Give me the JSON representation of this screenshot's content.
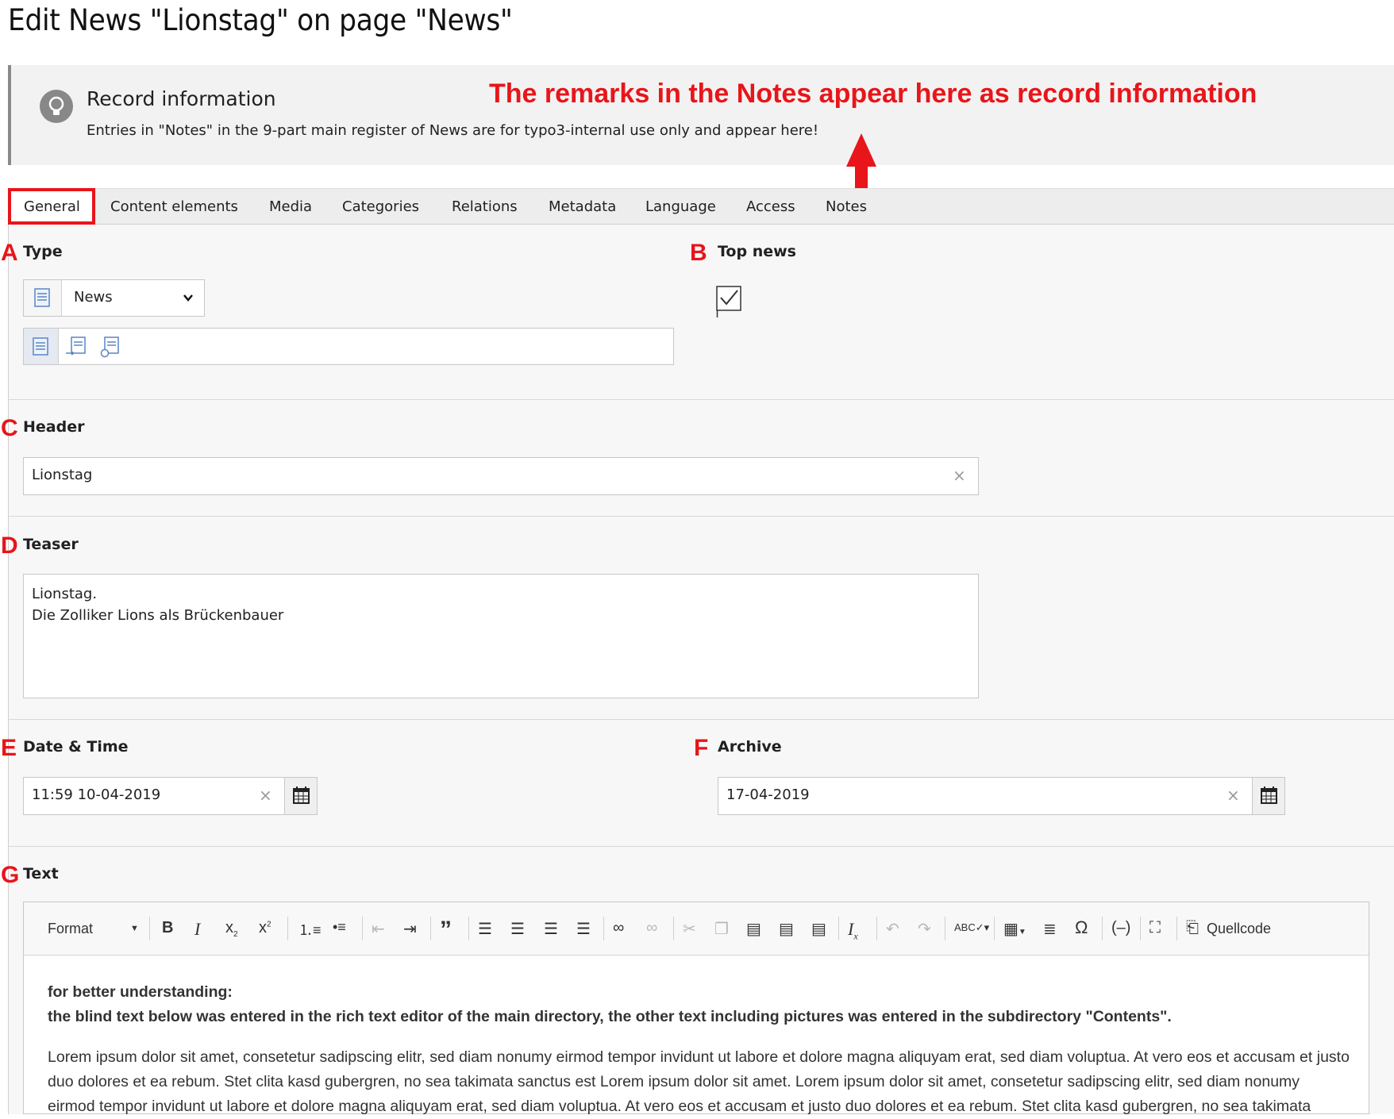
{
  "page": {
    "title": "Edit News \"Lionstag\" on page \"News\""
  },
  "record_info": {
    "title": "Record information",
    "text": "Entries in \"Notes\" in the 9-part main register of News are for typo3-internal use only and appear here!"
  },
  "annotation": {
    "main": "The remarks in the Notes appear here as record information"
  },
  "tabs": [
    "General",
    "Content elements",
    "Media",
    "Categories",
    "Relations",
    "Metadata",
    "Language",
    "Access",
    "Notes"
  ],
  "fields": {
    "type": {
      "marker": "A",
      "label": "Type",
      "value": "News"
    },
    "top_news": {
      "marker": "B",
      "label": "Top news",
      "checked": true
    },
    "header": {
      "marker": "C",
      "label": "Header",
      "value": "Lionstag"
    },
    "teaser": {
      "marker": "D",
      "label": "Teaser",
      "line1": "Lionstag.",
      "line2": "Die Zolliker Lions als Brückenbauer"
    },
    "datetime": {
      "marker": "E",
      "label": "Date & Time",
      "value": "11:59 10-04-2019"
    },
    "archive": {
      "marker": "F",
      "label": "Archive",
      "value": "17-04-2019"
    },
    "text": {
      "marker": "G",
      "label": "Text"
    }
  },
  "rte": {
    "format_label": "Format",
    "source_label": "Quellcode",
    "bold_line1": "for better understanding:",
    "bold_line2": "the blind text below was entered in the rich text editor of the main directory, the other text including pictures was entered in the subdirectory \"Contents\".",
    "para": "Lorem ipsum dolor sit amet, consetetur sadipscing elitr, sed diam nonumy eirmod tempor invidunt ut labore et dolore magna aliquyam erat, sed diam voluptua. At vero eos et accusam et justo duo dolores et ea rebum. Stet clita kasd gubergren, no sea takimata sanctus est Lorem ipsum dolor sit amet. Lorem ipsum dolor sit amet, consetetur sadipscing elitr, sed diam nonumy eirmod tempor invidunt ut labore et dolore magna aliquyam erat, sed diam voluptua. At vero eos et accusam et justo duo dolores et ea rebum. Stet clita kasd gubergren, no sea takimata"
  },
  "colors": {
    "annotation_red": "#e8151a"
  }
}
